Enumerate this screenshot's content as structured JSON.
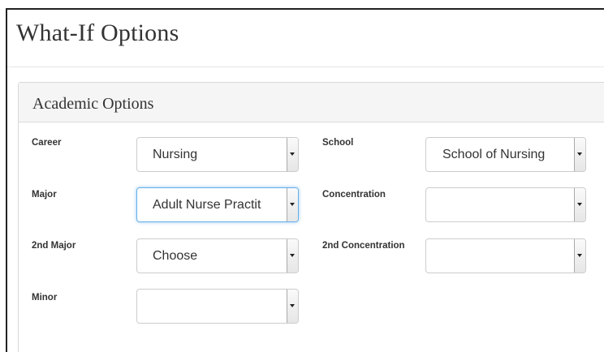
{
  "page": {
    "title": "What-If Options"
  },
  "panel": {
    "title": "Academic Options"
  },
  "fields": {
    "career": {
      "label": "Career",
      "value": "Nursing"
    },
    "school": {
      "label": "School",
      "value": "School of Nursing"
    },
    "major": {
      "label": "Major",
      "value": "Adult Nurse Practit"
    },
    "concentration": {
      "label": "Concentration",
      "value": ""
    },
    "second_major": {
      "label": "2nd Major",
      "value": "Choose"
    },
    "second_concentration": {
      "label": "2nd Concentration",
      "value": ""
    },
    "minor": {
      "label": "Minor",
      "value": ""
    }
  },
  "icons": {
    "dropdown": "chevron-down-icon"
  }
}
